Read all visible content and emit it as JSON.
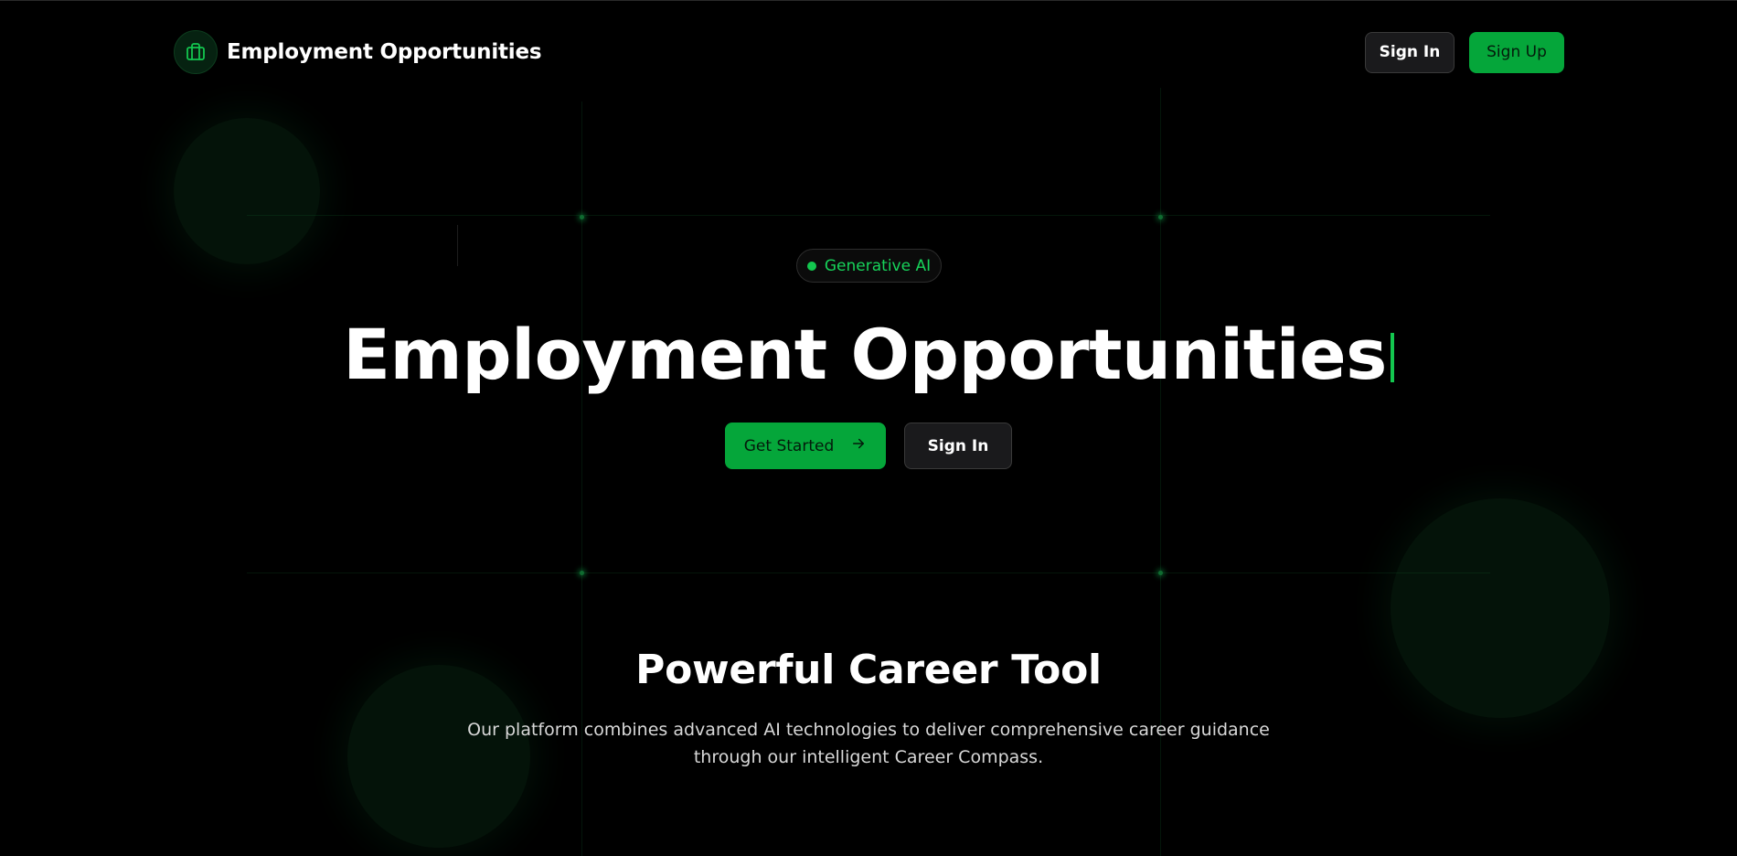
{
  "header": {
    "brand_name": "Employment Opportunities",
    "brand_icon": "briefcase-icon",
    "signin_label": "Sign In",
    "signup_label": "Sign Up"
  },
  "hero": {
    "badge_label": "Generative AI",
    "title": "Employment Opportunities",
    "get_started_label": "Get Started",
    "get_started_icon": "arrow-right-icon",
    "signin_label": "Sign In"
  },
  "features": {
    "title": "Powerful Career Tool",
    "description": "Our platform combines advanced AI technologies to deliver comprehensive career guidance through our intelligent Career Compass."
  },
  "colors": {
    "background": "#000000",
    "accent_green": "#05a63a",
    "accent_text_green": "#17d35a",
    "dark_button": "#1a1a1c"
  }
}
